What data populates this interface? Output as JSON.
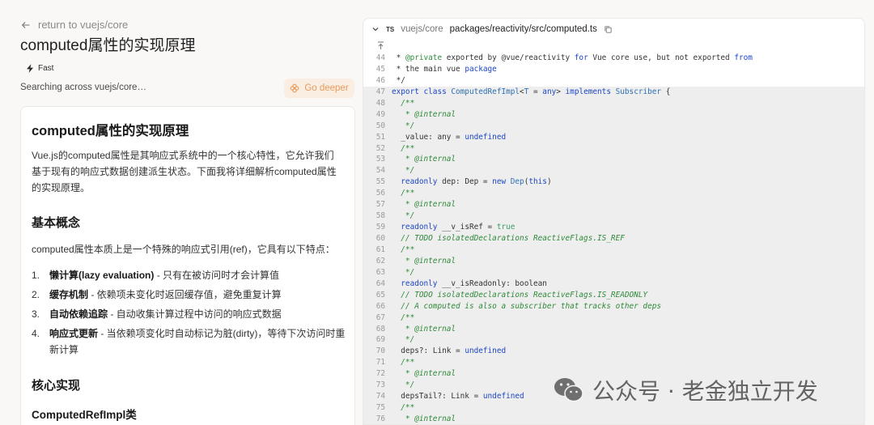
{
  "left": {
    "back_label": "return to vuejs/core",
    "title": "computed属性的实现原理",
    "fast_label": "Fast",
    "searching": "Searching across vuejs/core…",
    "go_deeper": "Go deeper"
  },
  "article": {
    "h1": "computed属性的实现原理",
    "intro": "Vue.js的computed属性是其响应式系统中的一个核心特性，它允许我们基于现有的响应式数据创建派生状态。下面我将详细解析computed属性的实现原理。",
    "h2_basic": "基本概念",
    "lead": "computed属性本质上是一个特殊的响应式引用(ref)，它具有以下特点：",
    "features": [
      {
        "num": "1.",
        "bold": "懒计算(lazy evaluation)",
        "text": " - 只有在被访问时才会计算值"
      },
      {
        "num": "2.",
        "bold": "缓存机制",
        "text": " - 依赖项未变化时返回缓存值，避免重复计算"
      },
      {
        "num": "3.",
        "bold": "自动依赖追踪",
        "text": " - 自动收集计算过程中访问的响应式数据"
      },
      {
        "num": "4.",
        "bold": "响应式更新",
        "text": " - 当依赖项变化时自动标记为脏(dirty)，等待下次访问时重新计算"
      }
    ],
    "h2_core": "核心实现",
    "h3_class": "ComputedRefImpl类"
  },
  "code_panel": {
    "lang_badge": "TS",
    "repo": "vuejs/core",
    "path": "packages/reactivity/src/computed.ts",
    "lines": [
      {
        "n": "44",
        "hl": false,
        "t": [
          [
            "",
            " * "
          ],
          [
            "doc",
            "@private"
          ],
          [
            "",
            " exported by @vue/reactivity "
          ],
          [
            "kw",
            "for"
          ],
          [
            "",
            " Vue core use, but not exported "
          ],
          [
            "kw",
            "from"
          ]
        ]
      },
      {
        "n": "45",
        "hl": false,
        "t": [
          [
            "",
            " * the main vue "
          ],
          [
            "kw",
            "package"
          ]
        ]
      },
      {
        "n": "46",
        "hl": false,
        "t": [
          [
            "",
            " */"
          ]
        ]
      },
      {
        "n": "47",
        "hl": true,
        "t": [
          [
            "kw",
            "export class "
          ],
          [
            "ty",
            "ComputedRefImpl"
          ],
          [
            "",
            "<"
          ],
          [
            "ty",
            "T"
          ],
          [
            "",
            " = "
          ],
          [
            "kw",
            "any"
          ],
          [
            "",
            "> "
          ],
          [
            "kw",
            "implements "
          ],
          [
            "ty",
            "Subscriber"
          ],
          [
            "",
            " {"
          ]
        ]
      },
      {
        "n": "48",
        "hl": true,
        "t": [
          [
            "cm",
            "  /**"
          ]
        ]
      },
      {
        "n": "49",
        "hl": true,
        "t": [
          [
            "cm",
            "   * @internal"
          ]
        ]
      },
      {
        "n": "50",
        "hl": true,
        "t": [
          [
            "cm",
            "   */"
          ]
        ]
      },
      {
        "n": "51",
        "hl": true,
        "t": [
          [
            "",
            "  _value: any = "
          ],
          [
            "kw",
            "undefined"
          ]
        ]
      },
      {
        "n": "52",
        "hl": true,
        "t": [
          [
            "cm",
            "  /**"
          ]
        ]
      },
      {
        "n": "53",
        "hl": true,
        "t": [
          [
            "cm",
            "   * @internal"
          ]
        ]
      },
      {
        "n": "54",
        "hl": true,
        "t": [
          [
            "cm",
            "   */"
          ]
        ]
      },
      {
        "n": "55",
        "hl": true,
        "t": [
          [
            "kw",
            "  readonly"
          ],
          [
            "",
            " dep: Dep = "
          ],
          [
            "kw",
            "new "
          ],
          [
            "ty",
            "Dep"
          ],
          [
            "",
            "("
          ],
          [
            "kw",
            "this"
          ],
          [
            "",
            ")"
          ]
        ]
      },
      {
        "n": "56",
        "hl": true,
        "t": [
          [
            "cm",
            "  /**"
          ]
        ]
      },
      {
        "n": "57",
        "hl": true,
        "t": [
          [
            "cm",
            "   * @internal"
          ]
        ]
      },
      {
        "n": "58",
        "hl": true,
        "t": [
          [
            "cm",
            "   */"
          ]
        ]
      },
      {
        "n": "59",
        "hl": true,
        "t": [
          [
            "kw",
            "  readonly"
          ],
          [
            "",
            " __v_isRef = "
          ],
          [
            "gr",
            "true"
          ]
        ]
      },
      {
        "n": "60",
        "hl": true,
        "t": [
          [
            "cm",
            "  // TODO isolatedDeclarations ReactiveFlags.IS_REF"
          ]
        ]
      },
      {
        "n": "61",
        "hl": true,
        "t": [
          [
            "cm",
            "  /**"
          ]
        ]
      },
      {
        "n": "62",
        "hl": true,
        "t": [
          [
            "cm",
            "   * @internal"
          ]
        ]
      },
      {
        "n": "63",
        "hl": true,
        "t": [
          [
            "cm",
            "   */"
          ]
        ]
      },
      {
        "n": "64",
        "hl": true,
        "t": [
          [
            "kw",
            "  readonly"
          ],
          [
            "",
            " __v_isReadonly: boolean"
          ]
        ]
      },
      {
        "n": "65",
        "hl": true,
        "t": [
          [
            "cm",
            "  // TODO isolatedDeclarations ReactiveFlags.IS_READONLY"
          ]
        ]
      },
      {
        "n": "66",
        "hl": true,
        "t": [
          [
            "cm",
            "  // A computed is also a subscriber that tracks other deps"
          ]
        ]
      },
      {
        "n": "67",
        "hl": true,
        "t": [
          [
            "cm",
            "  /**"
          ]
        ]
      },
      {
        "n": "68",
        "hl": true,
        "t": [
          [
            "cm",
            "   * @internal"
          ]
        ]
      },
      {
        "n": "69",
        "hl": true,
        "t": [
          [
            "cm",
            "   */"
          ]
        ]
      },
      {
        "n": "70",
        "hl": true,
        "t": [
          [
            "",
            "  deps?: Link = "
          ],
          [
            "kw",
            "undefined"
          ]
        ]
      },
      {
        "n": "71",
        "hl": true,
        "t": [
          [
            "cm",
            "  /**"
          ]
        ]
      },
      {
        "n": "72",
        "hl": true,
        "t": [
          [
            "cm",
            "   * @internal"
          ]
        ]
      },
      {
        "n": "73",
        "hl": true,
        "t": [
          [
            "cm",
            "   */"
          ]
        ]
      },
      {
        "n": "74",
        "hl": true,
        "t": [
          [
            "",
            "  depsTail?: Link = "
          ],
          [
            "kw",
            "undefined"
          ]
        ]
      },
      {
        "n": "75",
        "hl": true,
        "t": [
          [
            "cm",
            "  /**"
          ]
        ]
      },
      {
        "n": "76",
        "hl": true,
        "t": [
          [
            "cm",
            "   * @internal"
          ]
        ]
      }
    ]
  },
  "watermark": {
    "text": "公众号 · 老金独立开发"
  },
  "colors": {
    "accent_orange": "#e89a5c",
    "keyword_blue": "#1c46c7",
    "comment_green": "#2f8a3a"
  }
}
